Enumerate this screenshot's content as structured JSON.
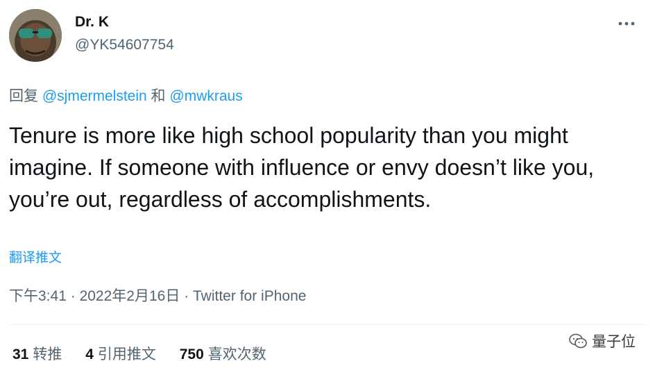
{
  "user": {
    "display_name": "Dr. K",
    "handle": "@YK54607754",
    "avatar_icon": "user-avatar-photo"
  },
  "reply": {
    "prefix": "回复",
    "mention_1": "@sjmermelstein",
    "connector": "和",
    "mention_2": "@mwkraus"
  },
  "tweet": {
    "text": "Tenure is more like high school popularity than you might imagine. If someone with influence or envy doesn’t like you, you’re out, regardless of accomplishments.",
    "translate_label": "翻译推文"
  },
  "meta": {
    "time": "下午3:41",
    "separator_1": "·",
    "date": "2022年2月16日",
    "separator_2": "·",
    "source": "Twitter for iPhone"
  },
  "stats": {
    "retweets_count": "31",
    "retweets_label": "转推",
    "quotes_count": "4",
    "quotes_label": "引用推文",
    "likes_count": "750",
    "likes_label": "喜欢次数"
  },
  "watermark": {
    "label": "量子位",
    "icon": "wechat-icon"
  },
  "colors": {
    "accent": "#1d9bf0",
    "secondary_text": "#536471",
    "primary_text": "#0f1419"
  }
}
